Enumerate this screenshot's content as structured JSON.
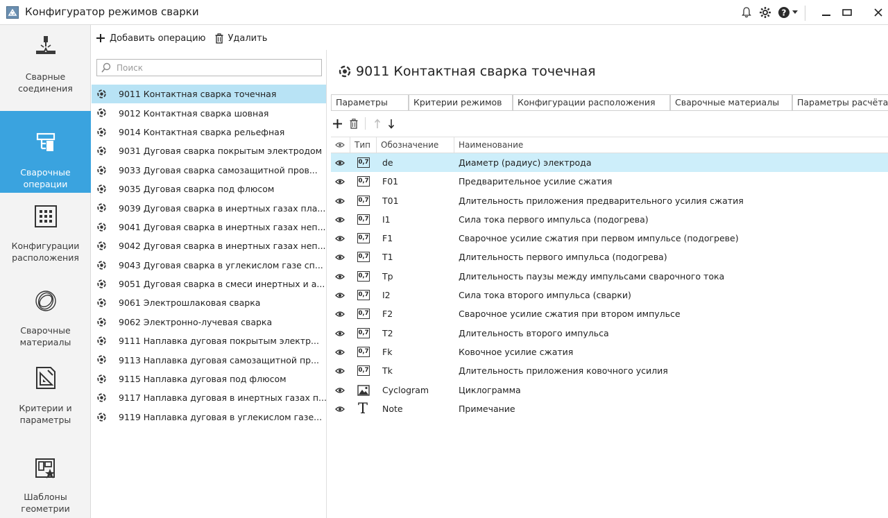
{
  "app": {
    "title": "Конфигуратор режимов сварки",
    "controls": [
      "bell-icon",
      "gear-icon",
      "help-icon",
      "minimize",
      "maximize",
      "close"
    ]
  },
  "nav": {
    "items": [
      {
        "label": "Сварные соединения",
        "icon": "weld-joint-icon",
        "active": false
      },
      {
        "label": "Сварочные операции",
        "icon": "operations-icon",
        "active": true
      },
      {
        "label": "Конфигурации расположения",
        "icon": "grid-dots-icon",
        "active": false
      },
      {
        "label": "Сварочные материалы",
        "icon": "wire-coil-icon",
        "active": false
      },
      {
        "label": "Критерии и параметры",
        "icon": "criteria-icon",
        "active": false
      },
      {
        "label": "Шаблоны геометрии",
        "icon": "template-icon",
        "active": false
      }
    ]
  },
  "toolbar": {
    "add_label": "Добавить операцию",
    "delete_label": "Удалить"
  },
  "search": {
    "placeholder": "Поиск",
    "value": ""
  },
  "operations": [
    {
      "label": "9011 Контактная сварка точечная",
      "selected": true
    },
    {
      "label": "9012 Контактная сварка шовная",
      "selected": false
    },
    {
      "label": "9014 Контактная сварка рельефная",
      "selected": false
    },
    {
      "label": "9031 Дуговая сварка покрытым электродом",
      "selected": false
    },
    {
      "label": "9033 Дуговая сварка самозащитной пров...",
      "selected": false
    },
    {
      "label": "9035 Дуговая сварка под флюсом",
      "selected": false
    },
    {
      "label": "9039 Дуговая сварка в инертных газах пла...",
      "selected": false
    },
    {
      "label": "9041 Дуговая сварка в инертных газах неп...",
      "selected": false
    },
    {
      "label": "9042 Дуговая сварка в инертных газах неп...",
      "selected": false
    },
    {
      "label": "9043 Дуговая сварка в углекислом газе сп...",
      "selected": false
    },
    {
      "label": "9051 Дуговая сварка в смеси инертных и а...",
      "selected": false
    },
    {
      "label": "9061 Электрошлаковая сварка",
      "selected": false
    },
    {
      "label": "9062 Электронно-лучевая сварка",
      "selected": false
    },
    {
      "label": "9111 Наплавка дуговая покрытым электр...",
      "selected": false
    },
    {
      "label": "9113 Наплавка дуговая самозащитной пр...",
      "selected": false
    },
    {
      "label": "9115 Наплавка дуговая под флюсом",
      "selected": false
    },
    {
      "label": "9117 Наплавка дуговая в инертных газах п...",
      "selected": false
    },
    {
      "label": "9119 Наплавка дуговая в углекислом газе...",
      "selected": false
    }
  ],
  "detail": {
    "title": "9011 Контактная сварка точечная",
    "tabs": [
      "Параметры",
      "Критерии режимов",
      "Конфигурации расположения",
      "Сварочные материалы",
      "Параметры расчёта"
    ],
    "columns": {
      "type": "Тип",
      "code": "Обозначение",
      "name": "Наименование"
    },
    "numeric_badge": "0,7",
    "rows": [
      {
        "type": "numeric",
        "code": "de",
        "name": "Диаметр (радиус) электрода",
        "selected": true
      },
      {
        "type": "numeric",
        "code": "F01",
        "name": "Предварительное усилие сжатия",
        "selected": false
      },
      {
        "type": "numeric",
        "code": "T01",
        "name": "Длительность приложения предварительного усилия сжатия",
        "selected": false
      },
      {
        "type": "numeric",
        "code": "I1",
        "name": "Сила тока первого импульса (подогрева)",
        "selected": false
      },
      {
        "type": "numeric",
        "code": "F1",
        "name": "Сварочное усилие сжатия при первом импульсе (подогреве)",
        "selected": false
      },
      {
        "type": "numeric",
        "code": "T1",
        "name": "Длительность первого импульса  (подогрева)",
        "selected": false
      },
      {
        "type": "numeric",
        "code": "Tp",
        "name": "Длительность паузы между импульсами сварочного тока",
        "selected": false
      },
      {
        "type": "numeric",
        "code": "I2",
        "name": "Сила тока второго импульса (сварки)",
        "selected": false
      },
      {
        "type": "numeric",
        "code": "F2",
        "name": "Сварочное усилие сжатия при втором импульсе",
        "selected": false
      },
      {
        "type": "numeric",
        "code": "T2",
        "name": "Длительность второго импульса",
        "selected": false
      },
      {
        "type": "numeric",
        "code": "Fk",
        "name": "Ковочное усилие сжатия",
        "selected": false
      },
      {
        "type": "numeric",
        "code": "Tk",
        "name": "Длительность приложения ковочного усилия",
        "selected": false
      },
      {
        "type": "image",
        "code": "Cyclogram",
        "name": "Циклограмма",
        "selected": false
      },
      {
        "type": "text",
        "code": "Note",
        "name": "Примечание",
        "selected": false
      }
    ]
  },
  "colors": {
    "accent": "#3aa3df",
    "selection": "#b8e3f5",
    "row_selection": "#cdeefa"
  }
}
